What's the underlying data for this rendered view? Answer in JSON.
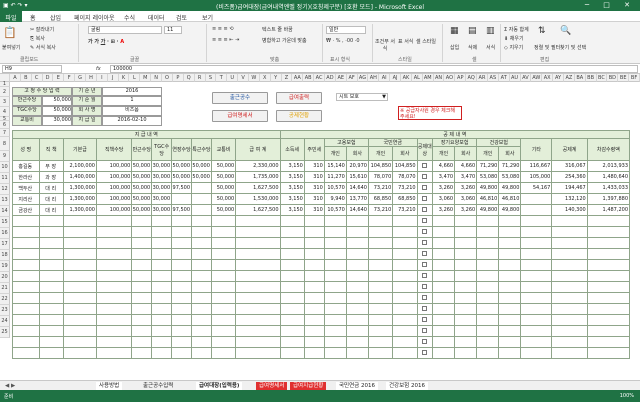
{
  "window": {
    "title": "(비즈폼)급여대장(급여내역엔벨 정기)(호칭제구분) [호환 모드] - Microsoft Excel",
    "controls": "─ □ ✕"
  },
  "tabs": [
    "파일",
    "홈",
    "삽입",
    "페이지 레이아웃",
    "수식",
    "데이터",
    "검토",
    "보기"
  ],
  "ribbon": {
    "paste": "붙여넣기",
    "cut": "잘라내기",
    "copy": "복사",
    "format_painter": "서식 복사",
    "font_name": "굴림",
    "font_size": "11",
    "wrap": "텍스트 줄 바꿈",
    "merge": "병합하고 가운데 맞춤",
    "number_format": "일반",
    "conditional": "조건부 서식",
    "format_table": "표 서식",
    "cell_style": "셀 스타일",
    "insert": "삽입",
    "delete": "삭제",
    "format": "서식",
    "autosum": "자동 합계",
    "fill": "채우기",
    "clear": "지우기",
    "sort": "정렬 및 필터",
    "find": "찾기 및 선택",
    "groups": [
      "클립보드",
      "글꼴",
      "맞춤",
      "표시 형식",
      "스타일",
      "셀",
      "편집"
    ]
  },
  "formula_bar": {
    "name_box": "H9",
    "fx": "fx",
    "value": "100000"
  },
  "columns": [
    "A",
    "B",
    "C",
    "D",
    "E",
    "F",
    "G",
    "H",
    "I",
    "J",
    "K",
    "L",
    "M",
    "N",
    "O",
    "P",
    "Q",
    "R",
    "S",
    "T",
    "U",
    "V",
    "W",
    "X",
    "Y",
    "Z",
    "AA",
    "AB",
    "AC",
    "AD",
    "AE",
    "AF",
    "AG",
    "AH",
    "AI",
    "AJ",
    "AK",
    "AL",
    "AM",
    "AN",
    "AO",
    "AP",
    "AQ",
    "AR",
    "AS",
    "AT",
    "AU",
    "AV",
    "AW",
    "AX",
    "AY",
    "AZ",
    "BA",
    "BB",
    "BC",
    "BD",
    "BE",
    "BF"
  ],
  "rows": [
    "1",
    "2",
    "3",
    "4",
    "5",
    "6",
    "7",
    "8",
    "9",
    "10",
    "11",
    "12",
    "13",
    "14",
    "15",
    "16",
    "17",
    "18",
    "19",
    "20",
    "21",
    "22",
    "23",
    "24",
    "25"
  ],
  "info": {
    "header": "고 정 수 당 입 력",
    "rows": [
      {
        "label": "만근수당",
        "value": "50,000",
        "label2": "기 준 월",
        "value2": "1"
      },
      {
        "label": "TGC수당",
        "value": "50,000",
        "label2": "회 사 명",
        "value2": "비즈폼"
      },
      {
        "label": "교통비",
        "value": "30,000",
        "label2": "지 급 일",
        "value2": "2016-02-10"
      }
    ],
    "year_label": "기 준 년",
    "year_value": "2016"
  },
  "buttons": {
    "b1": "출근공수",
    "b2": "급여출력",
    "b3": "급여명세서",
    "b4": "공제현황",
    "sheet_select": "시트 보호"
  },
  "note": "※ 공급자사원 경우 체크해 주세요!",
  "table": {
    "group1": "지 급 내 역",
    "group2": "공 제 내 역",
    "headers": [
      "성 명",
      "직 책",
      "기본급",
      "직책수당",
      "만근수당",
      "TGC수당",
      "연장수당",
      "특근수당",
      "교통비",
      "급 여 계",
      "소득세",
      "주민세",
      "개인",
      "회사",
      "개인",
      "회사",
      "공제대상",
      "개인",
      "회사",
      "개인",
      "회사",
      "기타",
      "공제계",
      "차감수령액"
    ],
    "subgroups": {
      "employ": "고용보험",
      "pension": "국민연금",
      "longterm": "장기요양보험",
      "health": "건강보험"
    },
    "data": [
      [
        "홍길동",
        "부 장",
        "2,100,000",
        "100,000",
        "50,000",
        "30,000",
        "50,000",
        "50,000",
        "50,000",
        "2,330,000",
        "3,150",
        "310",
        "15,140",
        "20,970",
        "104,850",
        "104,850",
        "",
        "4,660",
        "4,660",
        "71,290",
        "71,290",
        "116,667",
        "316,067",
        "2,013,933"
      ],
      [
        "한라산",
        "과 장",
        "1,400,000",
        "100,000",
        "50,000",
        "30,000",
        "50,000",
        "50,000",
        "50,000",
        "1,735,000",
        "3,150",
        "310",
        "11,270",
        "15,610",
        "78,070",
        "78,070",
        "",
        "3,470",
        "3,470",
        "53,080",
        "53,080",
        "105,000",
        "254,360",
        "1,480,640"
      ],
      [
        "백두산",
        "대 리",
        "1,300,000",
        "100,000",
        "50,000",
        "30,000",
        "97,500",
        "",
        "50,000",
        "1,627,500",
        "3,150",
        "310",
        "10,570",
        "14,640",
        "73,210",
        "73,210",
        "",
        "3,260",
        "3,260",
        "49,800",
        "49,800",
        "54,167",
        "194,467",
        "1,433,033"
      ],
      [
        "지리산",
        "대 리",
        "1,300,000",
        "100,000",
        "50,000",
        "30,000",
        "",
        "",
        "50,000",
        "1,530,000",
        "3,150",
        "310",
        "9,940",
        "13,770",
        "68,850",
        "68,850",
        "",
        "3,060",
        "3,060",
        "46,810",
        "46,810",
        "",
        "132,120",
        "1,397,880"
      ],
      [
        "금강산",
        "대 리",
        "1,300,000",
        "100,000",
        "50,000",
        "30,000",
        "97,500",
        "",
        "50,000",
        "1,627,500",
        "3,150",
        "310",
        "10,570",
        "14,640",
        "73,210",
        "73,210",
        "",
        "3,260",
        "3,260",
        "49,800",
        "49,800",
        "",
        "140,300",
        "1,487,200"
      ]
    ],
    "empty_rows": 13
  },
  "sheet_tabs": [
    "사용방법",
    "출근공수입력",
    "급여대장(입력용)",
    "급여명세서",
    "급여지급현황",
    "국민연금 2016",
    "건강보험 2016"
  ],
  "status": {
    "left": "준비",
    "zoom": "100%"
  },
  "colors": {
    "excel_green": "#1f7244",
    "header_green": "#e3efd9",
    "button_red": "#e03030"
  }
}
